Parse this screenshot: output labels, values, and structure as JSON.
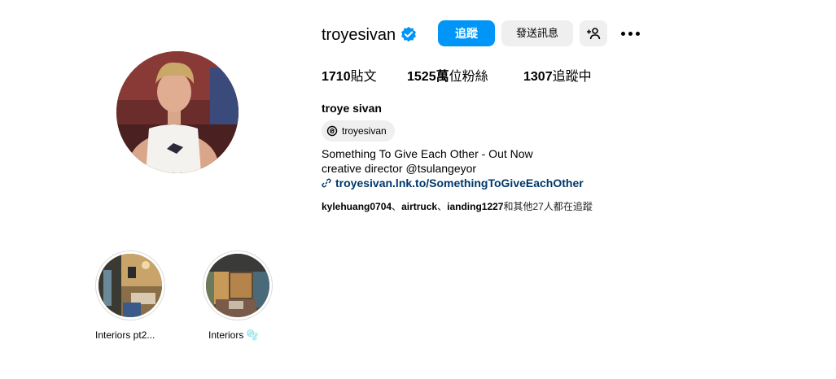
{
  "profile": {
    "username": "troyesivan",
    "verified_icon": "verified-badge-icon",
    "follow_label": "追蹤",
    "message_label": "發送訊息",
    "add_user_icon": "add-user-icon",
    "more_icon": "more-options-icon",
    "accent_color": "#0095f6"
  },
  "stats": {
    "posts_count": "1710",
    "posts_label": "貼文",
    "followers_count": "1525萬",
    "followers_label": "位粉絲",
    "following_count": "1307",
    "following_label": "追蹤中"
  },
  "bio": {
    "full_name": "troye sivan",
    "threads_handle": "troyesivan",
    "line1": "Something To Give Each Other - Out Now",
    "line2": "creative director @tsulangeyor",
    "link": "troyesivan.lnk.to/SomethingToGiveEachOther"
  },
  "followed_by": {
    "user1": "kylehuang0704",
    "sep1": "、",
    "user2": "airtruck",
    "sep2": "、",
    "user3": "ianding1227",
    "suffix": "和其他27人都在追蹤"
  },
  "highlights": [
    {
      "label": "Interiors pt2..."
    },
    {
      "label": "Interiors 🫧"
    }
  ]
}
